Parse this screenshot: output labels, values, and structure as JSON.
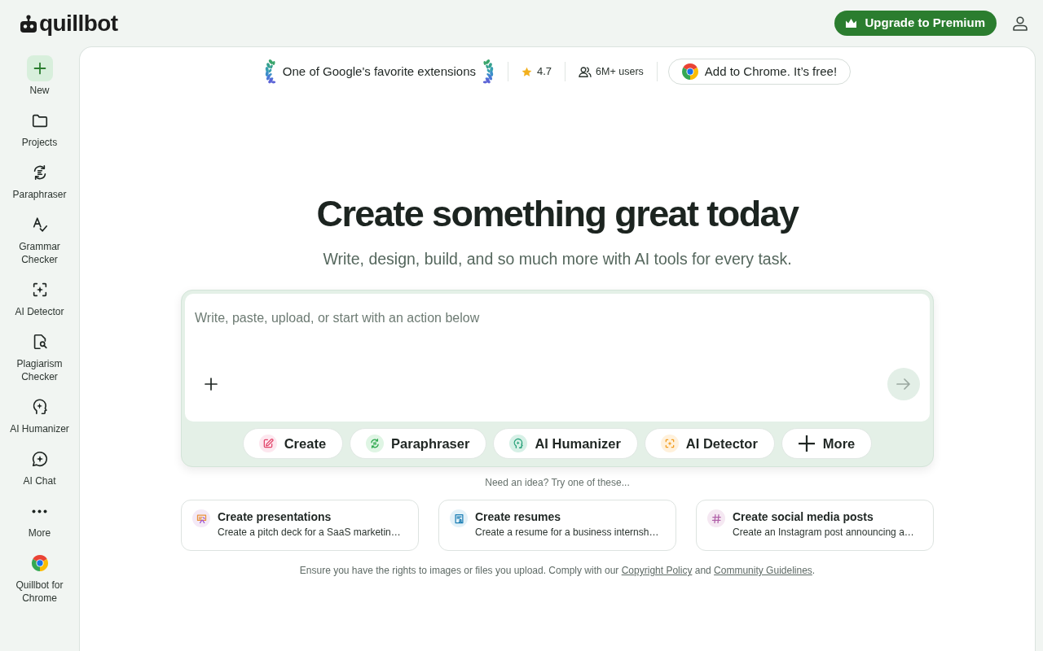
{
  "header": {
    "logo_text": "quillbot",
    "upgrade_button": "Upgrade to Premium"
  },
  "sidebar": {
    "items": [
      {
        "label": "New",
        "kind": "primary"
      },
      {
        "label": "Projects",
        "kind": "tool"
      },
      {
        "label": "Paraphraser",
        "kind": "tool"
      },
      {
        "label": "Grammar Checker",
        "kind": "tool"
      },
      {
        "label": "AI Detector",
        "kind": "tool"
      },
      {
        "label": "Plagiarism Checker",
        "kind": "tool"
      },
      {
        "label": "AI Humanizer",
        "kind": "tool"
      },
      {
        "label": "AI Chat",
        "kind": "tool"
      },
      {
        "label": "More",
        "kind": "tool"
      },
      {
        "label": "Quillbot for Chrome",
        "kind": "tool"
      }
    ]
  },
  "banner": {
    "award": "One of Google's favorite extensions",
    "rating": "4.7",
    "users": "6M+ users",
    "chrome_button": "Add to Chrome. It’s free!"
  },
  "hero": {
    "title": "Create something great today",
    "subtitle": "Write, design, build, and so much more with AI tools for every task."
  },
  "composer": {
    "placeholder": "Write, paste, upload, or start with an action below",
    "send_disabled": true,
    "actions": [
      "Create",
      "Paraphraser",
      "AI Humanizer",
      "AI Detector",
      "More"
    ]
  },
  "suggestions": {
    "prompt": "Need an idea? Try one of these...",
    "cards": [
      {
        "title": "Create presentations",
        "description": "Create a pitch deck for a SaaS marketin…"
      },
      {
        "title": "Create resumes",
        "description": "Create a resume for a business internsh…"
      },
      {
        "title": "Create social media posts",
        "description": "Create an Instagram post announcing a…"
      }
    ]
  },
  "footer": {
    "segments": [
      {
        "kind": "text",
        "text": "Ensure you have the rights to images or files you upload. Comply with our "
      },
      {
        "kind": "link",
        "text": "Copyright Policy"
      },
      {
        "kind": "text",
        "text": " and "
      },
      {
        "kind": "link",
        "text": "Community Guidelines"
      },
      {
        "kind": "text",
        "text": "."
      }
    ]
  }
}
